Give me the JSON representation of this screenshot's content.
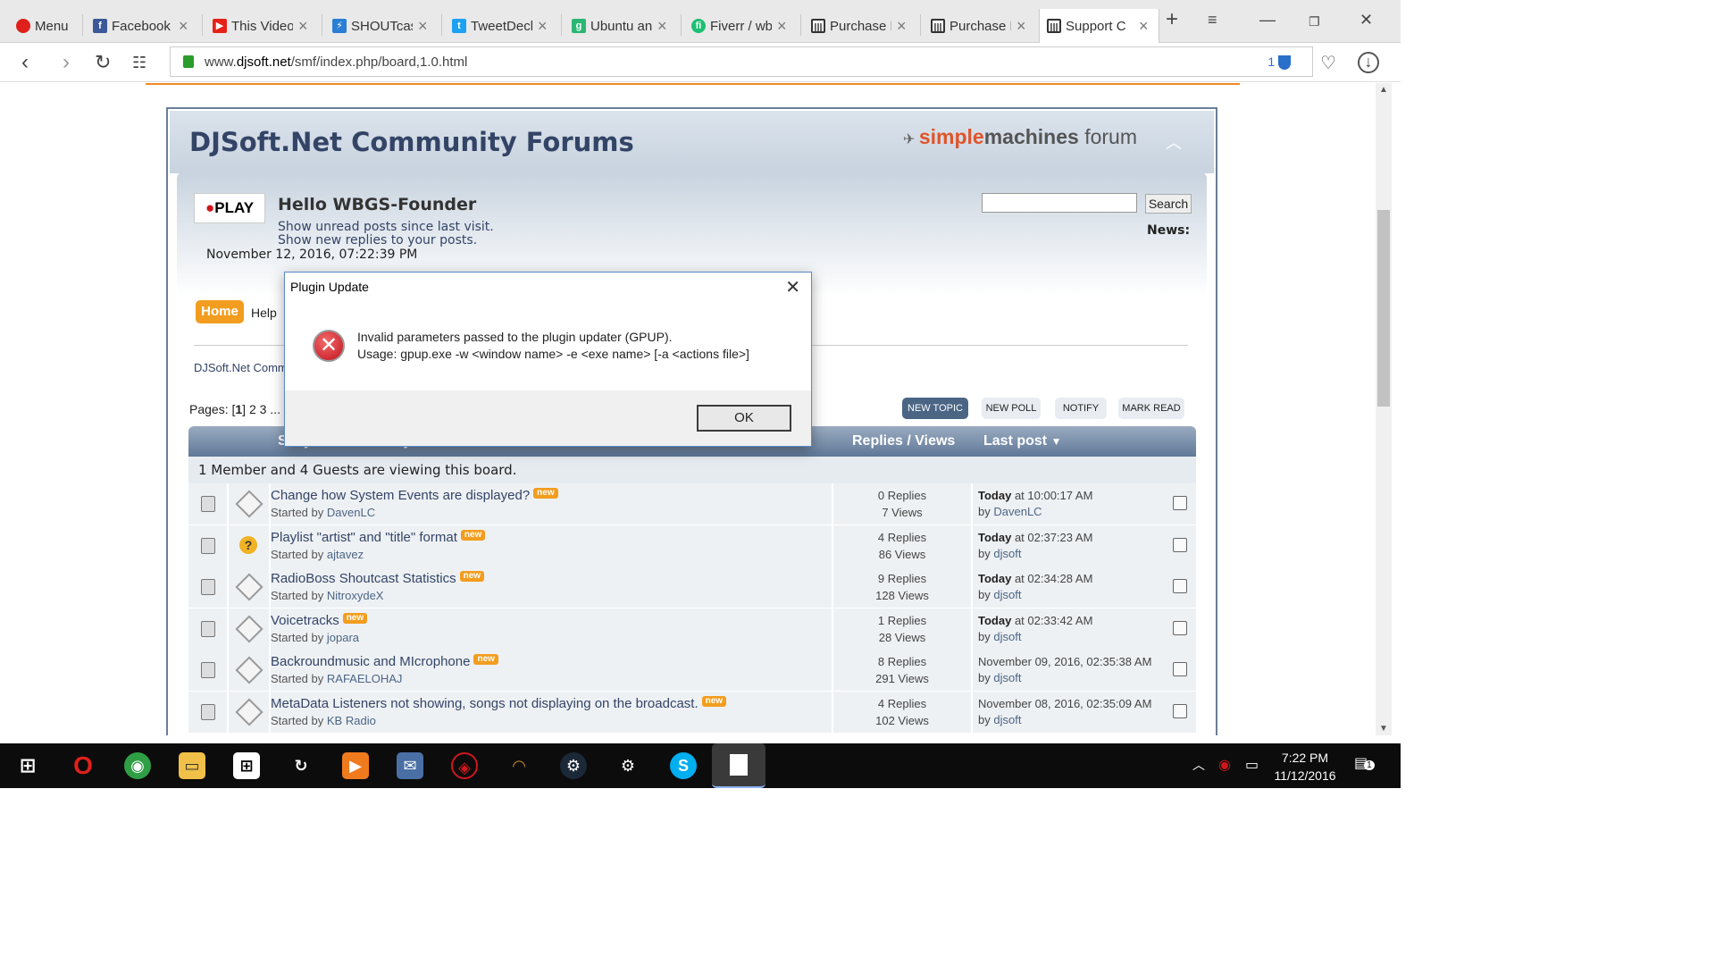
{
  "browser": {
    "menu_label": "Menu",
    "tabs": [
      {
        "label": "Facebook",
        "icon": "facebook-icon",
        "color": "#3b5998"
      },
      {
        "label": "This Video",
        "icon": "youtube-icon",
        "color": "#e62117"
      },
      {
        "label": "SHOUTcast",
        "icon": "shoutcast-icon",
        "color": "#2a7fd4"
      },
      {
        "label": "TweetDeck",
        "icon": "tweetdeck-icon",
        "color": "#1da1f2"
      },
      {
        "label": "Ubuntu an",
        "icon": "g-icon",
        "color": "#2bb673"
      },
      {
        "label": "Fiverr / wb",
        "icon": "fiverr-icon",
        "color": "#1dbf73"
      },
      {
        "label": "Purchase R",
        "icon": "purchase-icon",
        "color": "#333333"
      },
      {
        "label": "Purchase R",
        "icon": "purchase-icon",
        "color": "#333333"
      },
      {
        "label": "Support C",
        "icon": "support-icon",
        "color": "#333333"
      }
    ],
    "url_prefix": "www.",
    "url_domain": "djsoft.net",
    "url_path": "/smf/index.php/board,1.0.html",
    "badge_count": "1"
  },
  "forum": {
    "title": "DJSoft.Net Community Forums",
    "smf_logo_simple": "simple",
    "smf_logo_machines": "machines",
    "smf_logo_forum": " forum",
    "logo_text": "PLAY",
    "greeting": "Hello WBGS-Founder",
    "unread_link": "Show unread posts since last visit.",
    "replies_link": "Show new replies to your posts.",
    "datetime": "November 12, 2016, 07:22:39 PM",
    "search_button": "Search",
    "news_label": "News:",
    "nav_home": "Home",
    "nav_help": "Help",
    "breadcrumb": "DJSoft.Net Comm",
    "pages_label": "Pages: [",
    "pages_current": "1",
    "pages_rest": "] 2 3 ...",
    "buttons": {
      "new_topic": "NEW TOPIC",
      "new_poll": "NEW POLL",
      "notify": "NOTIFY",
      "mark_read": "MARK READ"
    },
    "table_header": {
      "subject": "Subject / Started by",
      "replies_views": "Replies / Views",
      "last_post": "Last post"
    },
    "viewing": "1 Member and 4 Guests are viewing this board.",
    "topics": [
      {
        "subject": "Change how System Events are displayed?",
        "new": "new",
        "started_by": "Started by",
        "starter": "DavenLC",
        "replies": "0 Replies",
        "views": "7 Views",
        "last_day": "Today",
        "last_time": " at 10:00:17 AM",
        "by": "by",
        "last_by": "DavenLC",
        "icon": "normal"
      },
      {
        "subject": "Playlist \"artist\" and \"title\" format",
        "new": "new",
        "started_by": "Started by",
        "starter": "ajtavez",
        "replies": "4 Replies",
        "views": "86 Views",
        "last_day": "Today",
        "last_time": " at 02:37:23 AM",
        "by": "by",
        "last_by": "djsoft",
        "icon": "question"
      },
      {
        "subject": "RadioBoss Shoutcast Statistics",
        "new": "new",
        "started_by": "Started by",
        "starter": "NitroxydeX",
        "replies": "9 Replies",
        "views": "128 Views",
        "last_day": "Today",
        "last_time": " at 02:34:28 AM",
        "by": "by",
        "last_by": "djsoft",
        "icon": "normal"
      },
      {
        "subject": "Voicetracks",
        "new": "new",
        "started_by": "Started by",
        "starter": "jopara",
        "replies": "1 Replies",
        "views": "28 Views",
        "last_day": "Today",
        "last_time": " at 02:33:42 AM",
        "by": "by",
        "last_by": "djsoft",
        "icon": "normal"
      },
      {
        "subject": "Backroundmusic and MIcrophone",
        "new": "new",
        "started_by": "Started by",
        "starter": "RAFAELOHAJ",
        "replies": "8 Replies",
        "views": "291 Views",
        "last_day": "",
        "last_time": "November 09, 2016, 02:35:38 AM",
        "by": "by",
        "last_by": "djsoft",
        "icon": "normal"
      },
      {
        "subject": "MetaData Listeners not showing, songs not displaying on the broadcast.",
        "new": "new",
        "started_by": "Started by",
        "starter": "KB Radio",
        "replies": "4 Replies",
        "views": "102 Views",
        "last_day": "",
        "last_time": "November 08, 2016, 02:35:09 AM",
        "by": "by",
        "last_by": "djsoft",
        "icon": "normal"
      }
    ]
  },
  "dialog": {
    "title": "Plugin Update",
    "message_line1": "Invalid parameters passed to the plugin updater (GPUP).",
    "message_line2": "Usage: gpup.exe -w <window name> -e <exe name> [-a <actions file>]",
    "ok_label": "OK"
  },
  "taskbar": {
    "time": "7:22 PM",
    "date": "11/12/2016",
    "notification_count": "1"
  }
}
